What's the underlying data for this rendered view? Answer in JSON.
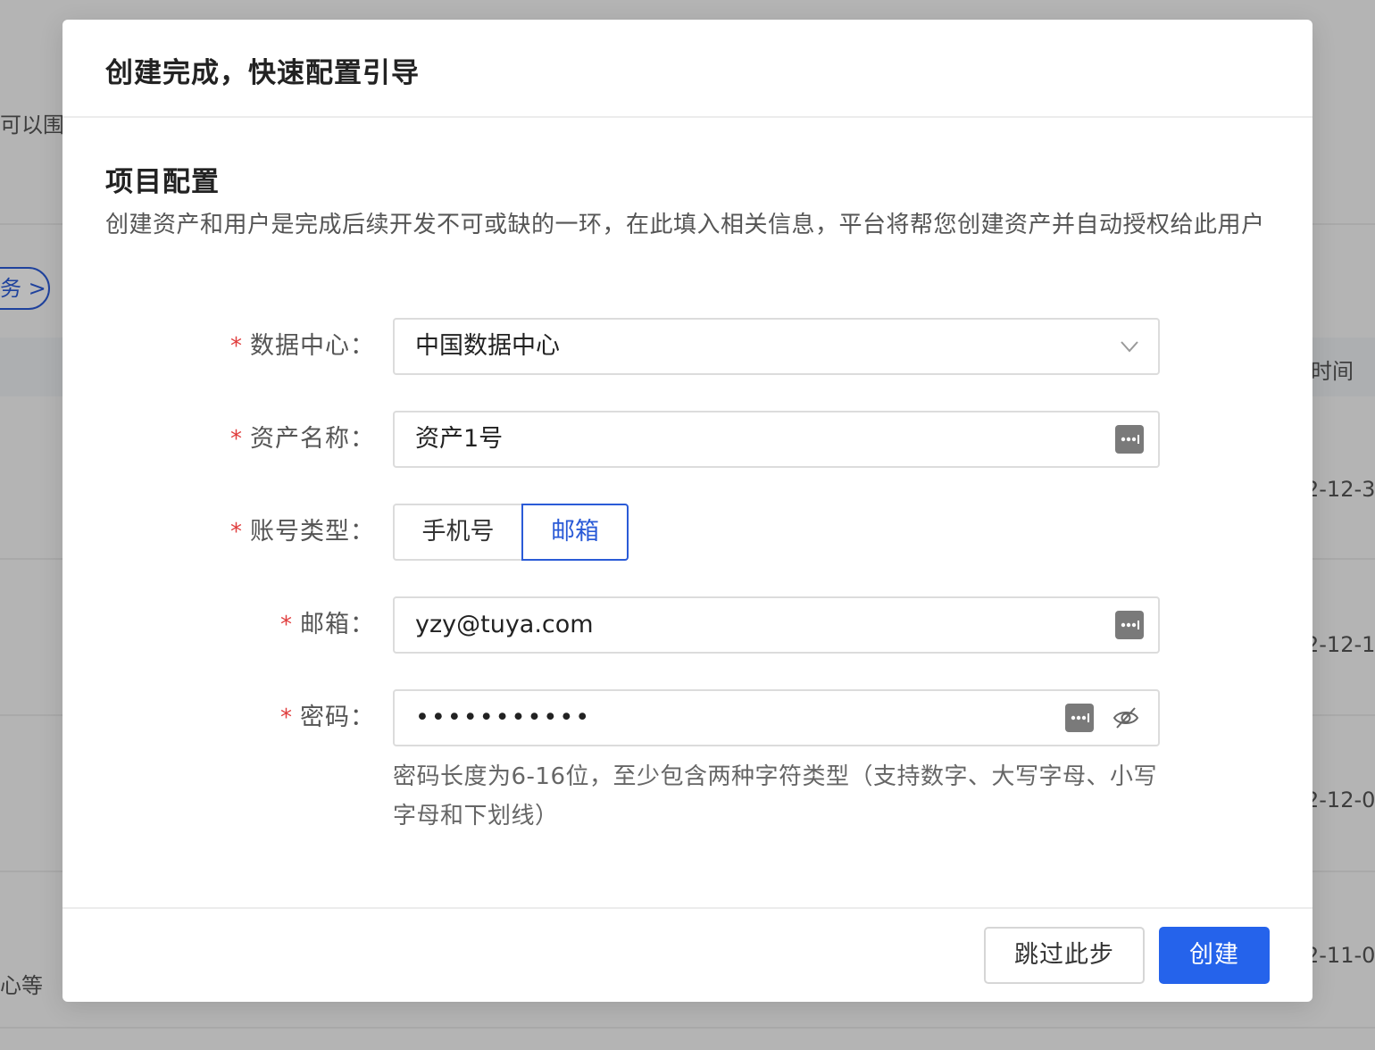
{
  "background": {
    "left_fragments": [
      "可以围绕",
      "务",
      "心等"
    ],
    "right_header": "时间",
    "right_dates": [
      "2-12-3",
      "2-12-1",
      "2-12-0",
      "2-11-0"
    ]
  },
  "modal": {
    "title": "创建完成，快速配置引导",
    "section_title": "项目配置",
    "section_desc": "创建资产和用户是完成后续开发不可或缺的一环，在此填入相关信息，平台将帮您创建资产并自动授权给此用户",
    "form": {
      "required_mark": "*",
      "data_center": {
        "label": "数据中心：",
        "value": "中国数据中心"
      },
      "asset_name": {
        "label": "资产名称：",
        "value": "资产1号"
      },
      "account_type": {
        "label": "账号类型：",
        "options": [
          "手机号",
          "邮箱"
        ],
        "selected": "邮箱"
      },
      "email": {
        "label": "邮箱：",
        "value": "yzy@tuya.com"
      },
      "password": {
        "label": "密码：",
        "masked_value": "•••••••••••",
        "hint": "密码长度为6-16位，至少包含两种字符类型（支持数字、大写字母、小写字母和下划线）"
      }
    },
    "footer": {
      "skip_label": "跳过此步",
      "create_label": "创建"
    },
    "colors": {
      "accent": "#2563eb",
      "required": "#e03e3e"
    }
  }
}
